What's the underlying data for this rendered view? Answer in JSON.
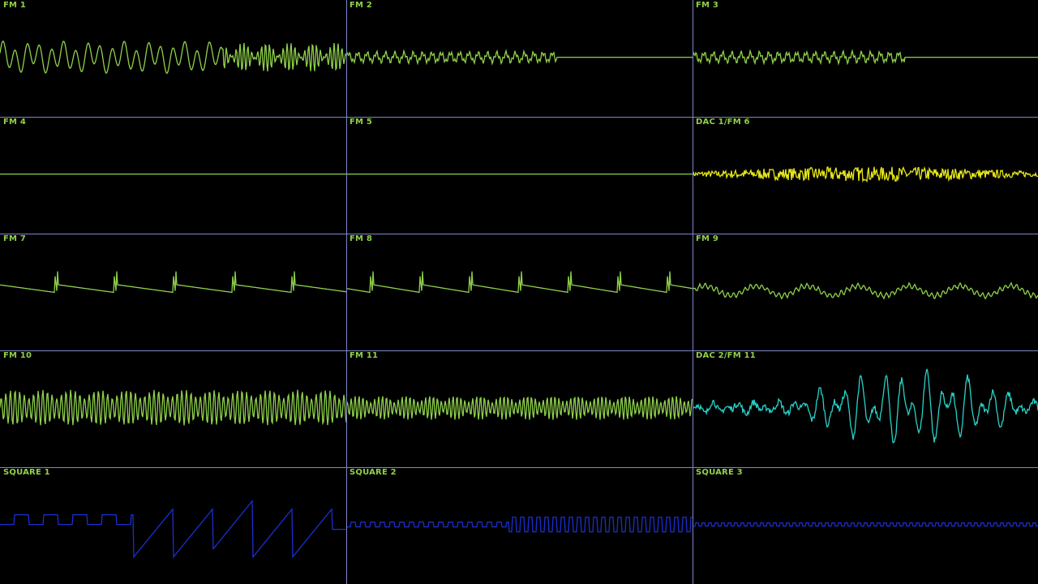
{
  "colors": {
    "grid": "#7f86c8",
    "label": "#8fd14a",
    "fm": "#8fd14a",
    "dac1": "#e6e619",
    "dac2": "#27d3c9",
    "square": "#1a2fd0"
  },
  "channels": [
    {
      "label": "FM 1",
      "color": "fm",
      "wave": "fm1"
    },
    {
      "label": "FM 2",
      "color": "fm",
      "wave": "fm2"
    },
    {
      "label": "FM 3",
      "color": "fm",
      "wave": "fm3"
    },
    {
      "label": "FM 4",
      "color": "fm",
      "wave": "flat"
    },
    {
      "label": "FM 5",
      "color": "fm",
      "wave": "flat"
    },
    {
      "label": "DAC 1/FM 6",
      "color": "dac1",
      "wave": "noise"
    },
    {
      "label": "FM 7",
      "color": "fm",
      "wave": "saw"
    },
    {
      "label": "FM 8",
      "color": "fm",
      "wave": "saw2"
    },
    {
      "label": "FM 9",
      "color": "fm",
      "wave": "fuzz"
    },
    {
      "label": "FM 10",
      "color": "fm",
      "wave": "dense"
    },
    {
      "label": "FM 11",
      "color": "fm",
      "wave": "dense2"
    },
    {
      "label": "DAC 2/FM 11",
      "color": "dac2",
      "wave": "drum"
    },
    {
      "label": "SQUARE 1",
      "color": "square",
      "wave": "square1"
    },
    {
      "label": "SQUARE 2",
      "color": "square",
      "wave": "square2"
    },
    {
      "label": "SQUARE 3",
      "color": "square",
      "wave": "square3"
    }
  ]
}
